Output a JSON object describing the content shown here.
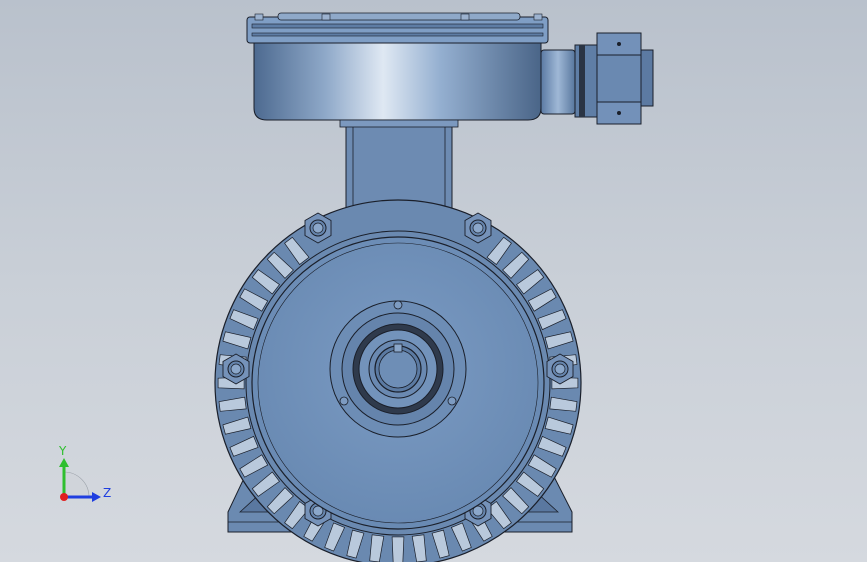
{
  "viewport": {
    "background_top": "#b9c1cc",
    "background_bottom": "#d5d9df",
    "model_color": "#6e8db5",
    "edge_color": "#1a1f2a"
  },
  "triad": {
    "y_label": "Y",
    "z_label": "Z",
    "y_color": "#2fbf2f",
    "z_color": "#1f3ee0",
    "x_color": "#e02020"
  }
}
